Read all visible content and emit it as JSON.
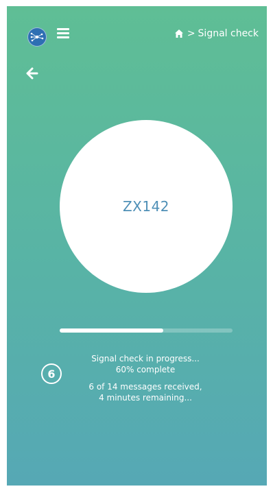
{
  "header": {
    "logo_icon": "network-globe-icon",
    "menu_icon": "hamburger-menu-icon",
    "breadcrumb": {
      "home_icon": "home-icon",
      "separator": ">",
      "current": "Signal check"
    }
  },
  "nav": {
    "back_icon": "arrow-left-icon"
  },
  "device": {
    "id": "ZX142"
  },
  "progress": {
    "percent": 60
  },
  "status": {
    "step_number": "6",
    "line1": "Signal check in progress...",
    "line2": "60% complete",
    "line3": "6 of 14 messages received,",
    "line4": "4 minutes remaining..."
  },
  "colors": {
    "gradient_top": "#5fbe95",
    "gradient_bottom": "#56a8b5",
    "device_id_text": "#4e8fb6",
    "logo_bg": "#2e6fb3"
  }
}
